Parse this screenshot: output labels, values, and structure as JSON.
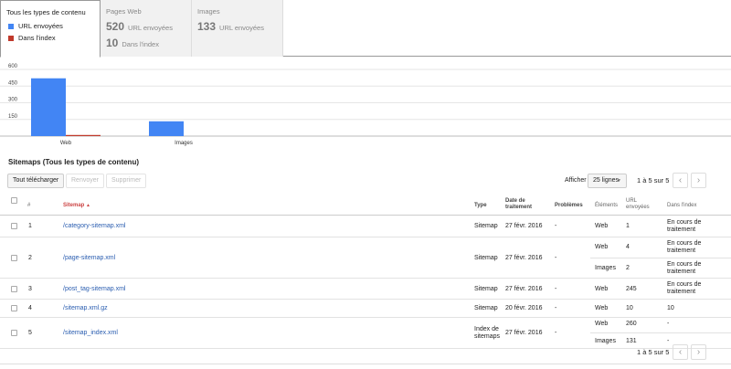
{
  "tabs": {
    "all": {
      "title": "Tous les types de contenu",
      "legend": [
        {
          "label": "URL envoyées",
          "color": "#4285f4"
        },
        {
          "label": "Dans l'index",
          "color": "#c0392b"
        }
      ]
    },
    "web": {
      "title": "Pages Web",
      "sent_value": "520",
      "sent_label": "URL envoyées",
      "index_value": "10",
      "index_label": "Dans l'index"
    },
    "images": {
      "title": "Images",
      "sent_value": "133",
      "sent_label": "URL envoyées"
    }
  },
  "chart_data": {
    "type": "bar",
    "categories": [
      "Web",
      "Images"
    ],
    "series": [
      {
        "name": "URL envoyées",
        "values": [
          520,
          133
        ],
        "color": "#4285f4"
      },
      {
        "name": "Dans l'index",
        "values": [
          10,
          0
        ],
        "color": "#c0392b"
      }
    ],
    "yticks": [
      "600",
      "450",
      "300",
      "150"
    ],
    "ylim": [
      0,
      600
    ]
  },
  "section": {
    "title": "Sitemaps (Tous les types de contenu)"
  },
  "toolbar": {
    "download": "Tout télécharger",
    "resend": "Renvoyer",
    "delete": "Supprimer",
    "show_label": "Afficher",
    "rows_select": "25 lignes",
    "range": "1 à 5 sur 5",
    "prev": "‹",
    "next": "›"
  },
  "table": {
    "headers": {
      "num": "#",
      "sitemap": "Sitemap",
      "sort_arrow": "▲",
      "type": "Type",
      "date": "Date de traitement",
      "problems": "Problèmes",
      "elements": "Éléments",
      "url_sent": "URL envoyées",
      "in_index": "Dans l'index"
    },
    "rows": [
      {
        "num": "1",
        "sitemap": "/category-sitemap.xml",
        "type": "Sitemap",
        "date": "27 févr. 2016",
        "problems": "-",
        "items": [
          {
            "el": "Web",
            "sent": "1",
            "idx": "En cours de traitement"
          }
        ]
      },
      {
        "num": "2",
        "sitemap": "/page-sitemap.xml",
        "type": "Sitemap",
        "date": "27 févr. 2016",
        "problems": "-",
        "items": [
          {
            "el": "Web",
            "sent": "4",
            "idx": "En cours de traitement"
          },
          {
            "el": "Images",
            "sent": "2",
            "idx": "En cours de traitement"
          }
        ]
      },
      {
        "num": "3",
        "sitemap": "/post_tag-sitemap.xml",
        "type": "Sitemap",
        "date": "27 févr. 2016",
        "problems": "-",
        "items": [
          {
            "el": "Web",
            "sent": "245",
            "idx": "En cours de traitement"
          }
        ]
      },
      {
        "num": "4",
        "sitemap": "/sitemap.xml.gz",
        "type": "Sitemap",
        "date": "20 févr. 2016",
        "problems": "-",
        "items": [
          {
            "el": "Web",
            "sent": "10",
            "idx": "10"
          }
        ]
      },
      {
        "num": "5",
        "sitemap": "/sitemap_index.xml",
        "type": "Index de sitemaps",
        "date": "27 févr. 2016",
        "problems": "-",
        "items": [
          {
            "el": "Web",
            "sent": "260",
            "idx": "-"
          },
          {
            "el": "Images",
            "sent": "131",
            "idx": "-"
          }
        ]
      }
    ]
  }
}
